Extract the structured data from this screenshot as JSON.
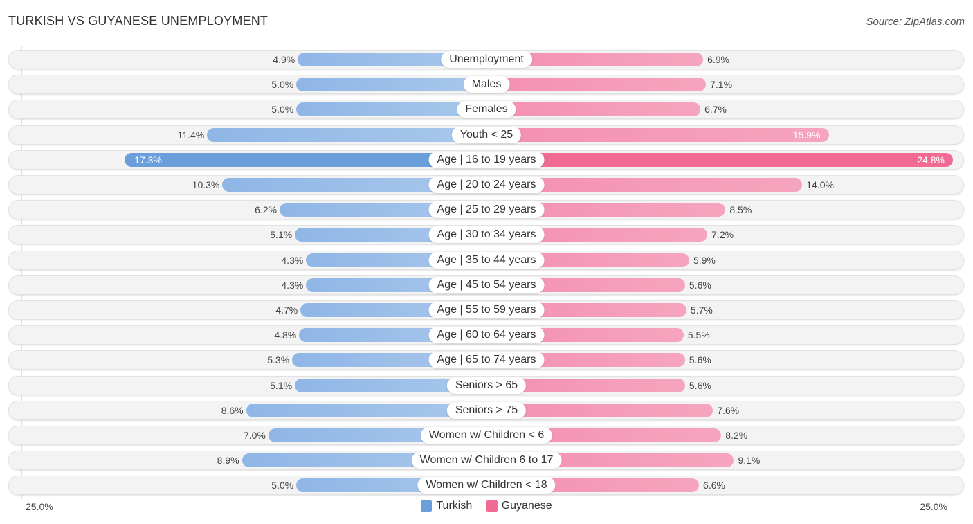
{
  "chart_data": {
    "type": "bar",
    "orientation": "horizontal-diverging",
    "title": "TURKISH VS GUYANESE UNEMPLOYMENT",
    "source": "Source: ZipAtlas.com",
    "categories": [
      "Unemployment",
      "Males",
      "Females",
      "Youth < 25",
      "Age | 16 to 19 years",
      "Age | 20 to 24 years",
      "Age | 25 to 29 years",
      "Age | 30 to 34 years",
      "Age | 35 to 44 years",
      "Age | 45 to 54 years",
      "Age | 55 to 59 years",
      "Age | 60 to 64 years",
      "Age | 65 to 74 years",
      "Seniors > 65",
      "Seniors > 75",
      "Women w/ Children < 6",
      "Women w/ Children 6 to 17",
      "Women w/ Children < 18"
    ],
    "series": [
      {
        "name": "Turkish",
        "color": "#6a9fdc",
        "values": [
          4.9,
          5.0,
          5.0,
          11.4,
          17.3,
          10.3,
          6.2,
          5.1,
          4.3,
          4.3,
          4.7,
          4.8,
          5.3,
          5.1,
          8.6,
          7.0,
          8.9,
          5.0
        ]
      },
      {
        "name": "Guyanese",
        "color": "#f06a93",
        "values": [
          6.9,
          7.1,
          6.7,
          15.9,
          24.8,
          14.0,
          8.5,
          7.2,
          5.9,
          5.6,
          5.7,
          5.5,
          5.6,
          5.6,
          7.6,
          8.2,
          9.1,
          6.6
        ]
      }
    ],
    "value_labels_left": [
      "4.9%",
      "5.0%",
      "5.0%",
      "11.4%",
      "17.3%",
      "10.3%",
      "6.2%",
      "5.1%",
      "4.3%",
      "4.3%",
      "4.7%",
      "4.8%",
      "5.3%",
      "5.1%",
      "8.6%",
      "7.0%",
      "8.9%",
      "5.0%"
    ],
    "value_labels_right": [
      "6.9%",
      "7.1%",
      "6.7%",
      "15.9%",
      "24.8%",
      "14.0%",
      "8.5%",
      "7.2%",
      "5.9%",
      "5.6%",
      "5.7%",
      "5.5%",
      "5.6%",
      "5.6%",
      "7.6%",
      "8.2%",
      "9.1%",
      "6.6%"
    ],
    "axis_left_label": "25.0%",
    "axis_right_label": "25.0%",
    "xlim": [
      25.0,
      25.0
    ],
    "legend_position": "bottom-center",
    "grid": false
  }
}
